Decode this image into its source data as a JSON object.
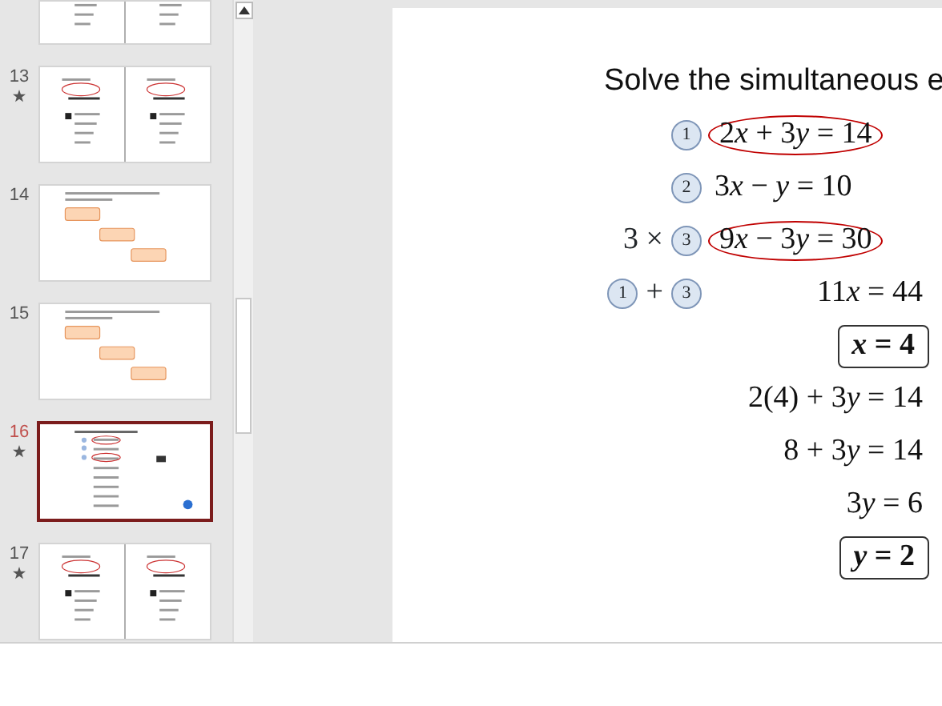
{
  "thumbnails": [
    {
      "kind": "two-column",
      "selected": false
    },
    {
      "number": "13",
      "kind": "two-column",
      "animated": true,
      "selected": false
    },
    {
      "number": "14",
      "kind": "boxes",
      "animated": false,
      "selected": false
    },
    {
      "number": "15",
      "kind": "boxes",
      "animated": false,
      "selected": false
    },
    {
      "number": "16",
      "kind": "solution",
      "animated": true,
      "selected": true
    },
    {
      "number": "17",
      "kind": "two-column",
      "animated": true,
      "selected": false
    }
  ],
  "slide": {
    "title": "Solve the simultaneous e",
    "rows": [
      {
        "label": [
          {
            "kind": "circle",
            "text": "1"
          }
        ],
        "equation": [
          {
            "text": "2"
          },
          {
            "text": "x",
            "kind": "variable"
          },
          {
            "text": " + 3"
          },
          {
            "text": "y",
            "kind": "variable"
          },
          {
            "text": " = 14"
          }
        ],
        "circled": true,
        "boxed": false
      },
      {
        "label": [
          {
            "kind": "circle",
            "text": "2"
          }
        ],
        "equation": [
          {
            "text": "3"
          },
          {
            "text": "x",
            "kind": "variable"
          },
          {
            "text": " − "
          },
          {
            "text": "y",
            "kind": "variable"
          },
          {
            "text": " = 10"
          }
        ],
        "circled": false,
        "boxed": false
      },
      {
        "label": [
          {
            "kind": "text",
            "text": "3 ×"
          },
          {
            "kind": "circle",
            "text": "3"
          }
        ],
        "equation": [
          {
            "text": "9"
          },
          {
            "text": "x",
            "kind": "variable"
          },
          {
            "text": " − 3"
          },
          {
            "text": "y",
            "kind": "variable"
          },
          {
            "text": " = 30"
          }
        ],
        "circled": true,
        "boxed": false
      },
      {
        "label": [
          {
            "kind": "circle",
            "text": "1"
          },
          {
            "kind": "text",
            "text": "+"
          },
          {
            "kind": "circle",
            "text": "3"
          }
        ],
        "equation": [
          {
            "text": "11"
          },
          {
            "text": "x",
            "kind": "variable"
          },
          {
            "text": " = 44"
          }
        ],
        "circled": false,
        "boxed": false
      },
      {
        "label": [],
        "equation": [
          {
            "text": "x",
            "kind": "variable"
          },
          {
            "text": " = 4"
          }
        ],
        "circled": false,
        "boxed": true
      },
      {
        "label": [],
        "equation": [
          {
            "text": "2(4) + 3"
          },
          {
            "text": "y",
            "kind": "variable"
          },
          {
            "text": " = 14"
          }
        ],
        "circled": false,
        "boxed": false
      },
      {
        "label": [],
        "equation": [
          {
            "text": "8 + 3"
          },
          {
            "text": "y",
            "kind": "variable"
          },
          {
            "text": " = 14"
          }
        ],
        "circled": false,
        "boxed": false
      },
      {
        "label": [],
        "equation": [
          {
            "text": "3"
          },
          {
            "text": "y",
            "kind": "variable"
          },
          {
            "text": " = 6"
          }
        ],
        "circled": false,
        "boxed": false
      },
      {
        "label": [],
        "equation": [
          {
            "text": "y",
            "kind": "variable"
          },
          {
            "text": " = 2"
          }
        ],
        "circled": false,
        "boxed": true
      }
    ]
  }
}
